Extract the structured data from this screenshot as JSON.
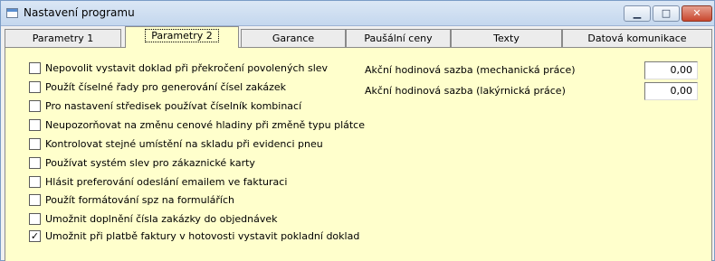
{
  "window": {
    "title": "Nastavení programu",
    "min_symbol": "▁",
    "max_symbol": "□",
    "close_symbol": "✕"
  },
  "tabs": [
    {
      "label": "Parametry 1",
      "active": false
    },
    {
      "label": "Parametry 2",
      "active": true
    },
    {
      "label": "Garance",
      "active": false
    },
    {
      "label": "Paušální ceny",
      "active": false
    },
    {
      "label": "Texty",
      "active": false
    },
    {
      "label": "Datová komunikace",
      "active": false
    }
  ],
  "options": [
    {
      "label": "Nepovolit vystavit doklad při překročení povolených slev",
      "checked": false
    },
    {
      "label": "Použít číselné řady pro generování čísel zakázek",
      "checked": false
    },
    {
      "label": "Pro nastavení středisek používat číselník kombinací",
      "checked": false
    },
    {
      "label": "Neupozorňovat na změnu cenové hladiny při změně typu plátce",
      "checked": false
    },
    {
      "label": "Kontrolovat stejné umístění na skladu při evidenci pneu",
      "checked": false
    },
    {
      "label": "Používat systém slev pro zákaznické karty",
      "checked": false
    },
    {
      "label": "Hlásit preferování odeslání emailem ve fakturaci",
      "checked": false
    },
    {
      "label": "Použít formátování spz na formulářích",
      "checked": false
    },
    {
      "label": "Umožnit doplnění čísla zakázky do objednávek",
      "checked": false
    },
    {
      "label": "Umožnit při platbě faktury v hotovosti vystavit pokladní doklad",
      "checked": true
    }
  ],
  "fields": [
    {
      "label": "Akční hodinová  sazba (mechanická práce)",
      "value": "0,00"
    },
    {
      "label": "Akční hodinová  sazba (lakýrnická práce)",
      "value": "0,00"
    }
  ],
  "colors": {
    "panel": "#ffffcc",
    "window": "#f0f0f0",
    "close_button": "#c9472e"
  }
}
